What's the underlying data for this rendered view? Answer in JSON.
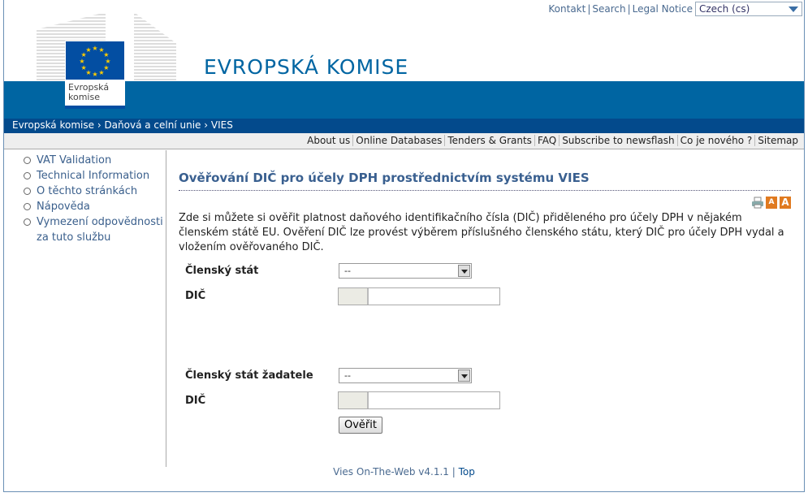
{
  "top_links": [
    "Kontakt",
    "Search",
    "Legal Notice"
  ],
  "language": "Czech (cs)",
  "logo_text": "Evropská komise",
  "site_title": "EVROPSKÁ KOMISE",
  "breadcrumb": [
    "Evropská komise",
    "Daňová a celní unie",
    "VIES"
  ],
  "nav": [
    "About us",
    "Online Databases",
    "Tenders & Grants",
    "FAQ",
    "Subscribe to newsflash",
    "Co je nového ?",
    "Sitemap"
  ],
  "sidebar": [
    "VAT Validation",
    "Technical Information",
    "O těchto stránkách",
    "Nápověda",
    "Vymezení odpovědnosti za tuto službu"
  ],
  "page_title": "Ověřování DIČ pro účely DPH prostřednictvím systému VIES",
  "intro": "Zde si můžete si ověřit platnost daňového identifikačního čísla (DIČ) přiděleného pro účely DPH v nějakém členském státě EU. Ověření DIČ lze provést výběrem příslušného členského státu, který DIČ pro účely DPH vydal a vložením ověřovaného DIČ.",
  "form": {
    "member_state_label": "Členský stát",
    "member_state_value": "--",
    "vat_label": "DIČ",
    "requester_state_label": "Členský stát žadatele",
    "requester_state_value": "--",
    "requester_vat_label": "DIČ",
    "submit": "Ověřit"
  },
  "footer": {
    "version": "Vies On-The-Web v4.1.1",
    "top": "Top"
  },
  "colors": {
    "brand": "#0065a2",
    "breadcrumb": "#034a8c",
    "flag": "#034ea2"
  }
}
